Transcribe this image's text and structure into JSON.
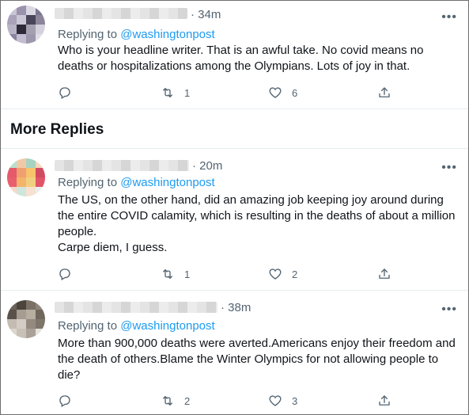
{
  "tweets": [
    {
      "time": "· 34m",
      "replying_prefix": "Replying to ",
      "replying_handle": "@washingtonpost",
      "text": "Who is your headline writer. That is an awful take. No covid means no deaths or hospitalizations among the Olympians. Lots of joy in that.",
      "retweets": "1",
      "likes": "6",
      "avatar_colors": [
        "#c9c4d6",
        "#9b93ad",
        "#dcd8e3",
        "#7d7492",
        "#a9a2b8",
        "#ccc7d7",
        "#4a4458",
        "#8c8599",
        "#b9b3c6",
        "#2e2a38",
        "#a5a0b0",
        "#d4d0dc",
        "#8b84a0",
        "#c2bdd0",
        "#9d97ac",
        "#e1dee8"
      ]
    },
    {
      "time": "· 20m",
      "replying_prefix": "Replying to ",
      "replying_handle": "@washingtonpost",
      "text": "The US, on the other hand, did an amazing job keeping joy around during the entire COVID calamity, which is resulting in the deaths of about a million people.\nCarpe diem, I guess.",
      "retweets": "1",
      "likes": "2",
      "avatar_colors": [
        "#b8e0cf",
        "#f2c9a8",
        "#a7d3c2",
        "#f5d9bd",
        "#e45a6a",
        "#f0a070",
        "#f7c36b",
        "#d14c62",
        "#e8606d",
        "#f4b46a",
        "#f0cf80",
        "#e05567",
        "#f6d8c6",
        "#cfe6dc",
        "#f7e1d0",
        "#e9f0ec"
      ]
    },
    {
      "time": "· 38m",
      "replying_prefix": "Replying to ",
      "replying_handle": "@washingtonpost",
      "text": "More than 900,000 deaths were averted.Americans enjoy their freedom and the death of others.Blame the Winter Olympics for not allowing people to die?",
      "retweets": "2",
      "likes": "3",
      "avatar_colors": [
        "#6b6157",
        "#4c453e",
        "#7a7066",
        "#8f857a",
        "#5a524a",
        "#a69c90",
        "#b7ae a2",
        "#6f665c",
        "#c4bcb2",
        "#d3ccc4",
        "#948a80",
        "#7e756b",
        "#dcd6cf",
        "#c8c1b8",
        "#aaa198",
        "#e6e1db"
      ]
    }
  ],
  "section_title": "More Replies",
  "icons": {
    "reply": "speech-bubble-icon",
    "retweet": "retweet-icon",
    "like": "heart-icon",
    "share": "share-upload-icon",
    "more": "more-horizontal-icon"
  },
  "colors": {
    "link": "#1d9bf0",
    "muted": "#536471",
    "text": "#0f1419"
  }
}
